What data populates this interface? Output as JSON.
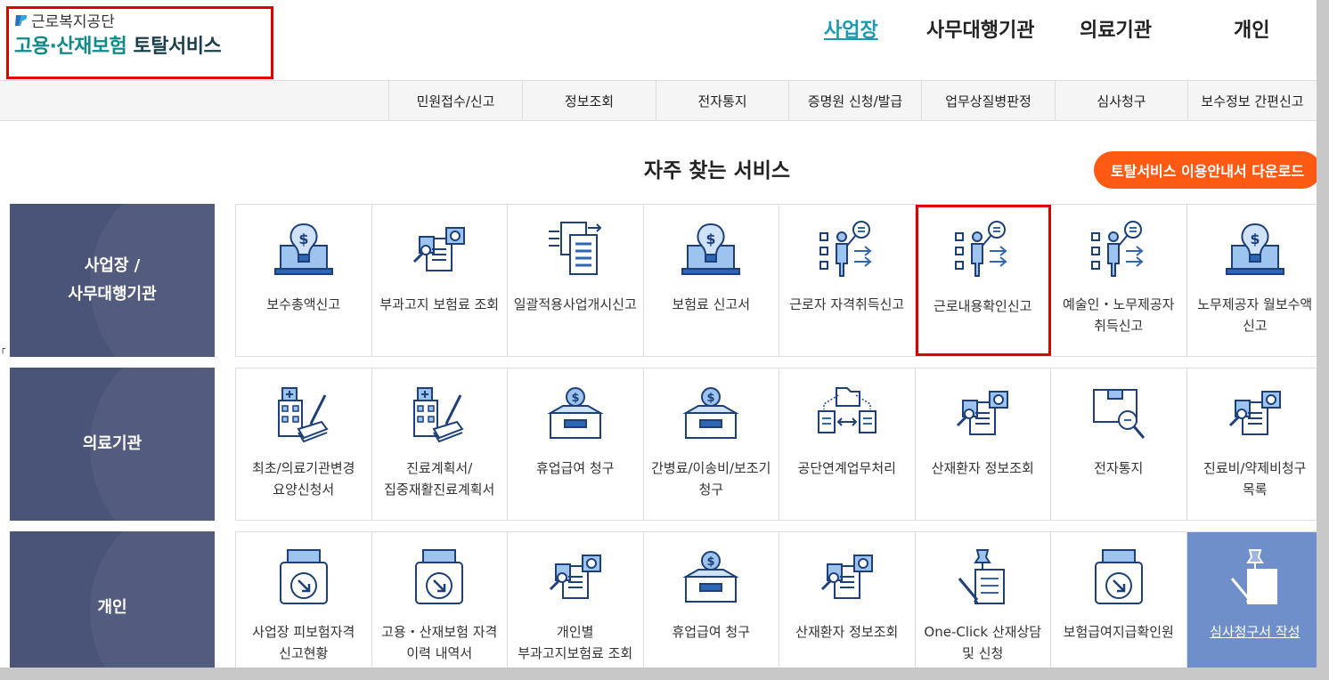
{
  "header": {
    "org_name": "근로복지공단",
    "logo_teal": "고용·산재보험",
    "logo_dark": "토탈서비스"
  },
  "top_nav": [
    {
      "label": "사업장",
      "active": true
    },
    {
      "label": "사무대행기관",
      "active": false
    },
    {
      "label": "의료기관",
      "active": false
    },
    {
      "label": "개인",
      "active": false
    }
  ],
  "sub_nav": [
    "민원접수/신고",
    "정보조회",
    "전자통지",
    "증명원 신청/발급",
    "업무상질병판정",
    "심사청구",
    "보수정보 간편신고"
  ],
  "main": {
    "title": "자주 찾는 서비스",
    "download_button": "토탈서비스 이용안내서 다운로드"
  },
  "sections": [
    {
      "category": "사업장 /\n사무대행기관",
      "tiles": [
        {
          "label": "보수총액신고",
          "icon": "laptop-coin-icon"
        },
        {
          "label": "부과고지 보험료 조회",
          "icon": "document-search-icon"
        },
        {
          "label": "일괄적용사업개시신고",
          "icon": "document-transfer-icon"
        },
        {
          "label": "보험료 신고서",
          "icon": "laptop-coin-icon"
        },
        {
          "label": "근로자 자격취득신고",
          "icon": "presenter-checklist-icon"
        },
        {
          "label": "근로내용확인신고",
          "icon": "presenter-checklist-icon",
          "highlighted": true
        },
        {
          "label": "예술인・노무제공자 취득신고",
          "icon": "presenter-checklist-icon"
        },
        {
          "label": "노무제공자 월보수액 신고",
          "icon": "laptop-coin-icon"
        }
      ]
    },
    {
      "category": "의료기관",
      "tiles": [
        {
          "label": "최초/의료기관변경 요양신청서",
          "icon": "hospital-pen-icon"
        },
        {
          "label": "진료계획서/집중재활진료계획서",
          "icon": "hospital-pen-icon"
        },
        {
          "label": "휴업급여 청구",
          "icon": "coin-box-icon"
        },
        {
          "label": "간병료/이송비/보조기 청구",
          "icon": "coin-box-icon"
        },
        {
          "label": "공단연계업무처리",
          "icon": "folder-exchange-icon"
        },
        {
          "label": "산재환자 정보조회",
          "icon": "document-search-icon"
        },
        {
          "label": "전자통지",
          "icon": "package-search-icon"
        },
        {
          "label": "진료비/약제비청구 목록",
          "icon": "document-search-icon"
        }
      ]
    },
    {
      "category": "개인",
      "tiles": [
        {
          "label": "사업장 피보험자격 신고현황",
          "icon": "printer-download-icon"
        },
        {
          "label": "고용・산재보험 자격 이력 내역서",
          "icon": "printer-download-icon"
        },
        {
          "label": "개인별 부과고지보험료 조회",
          "icon": "document-search-icon"
        },
        {
          "label": "휴업급여 청구",
          "icon": "coin-box-icon"
        },
        {
          "label": "산재환자 정보조회",
          "icon": "document-search-icon"
        },
        {
          "label": "One-Click 산재상담 및 신청",
          "icon": "pin-document-icon"
        },
        {
          "label": "보험급여지급확인원",
          "icon": "printer-download-icon"
        },
        {
          "label": "심사청구서 작성",
          "icon": "pin-document-icon",
          "selected": true
        }
      ]
    }
  ],
  "colors": {
    "accent_teal": "#1a9ab0",
    "category_bg": "#4a5478",
    "download_orange": "#ff5a14",
    "selected_tile": "#6f8fca",
    "highlight_red": "#e00000",
    "icon_blue": "#2f66b3"
  }
}
